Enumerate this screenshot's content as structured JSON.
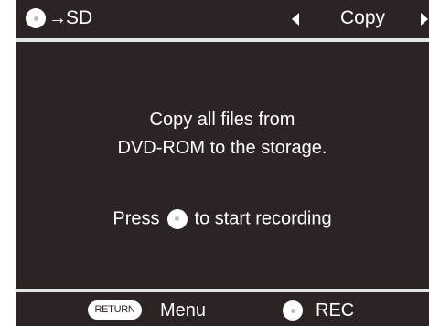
{
  "header": {
    "arrow": "→",
    "destination": "SD",
    "mode": "Copy"
  },
  "message": {
    "line1": "Copy all files from",
    "line2": "DVD-ROM to the storage.",
    "press_prefix": "Press",
    "press_suffix": "to start recording"
  },
  "footer": {
    "return_label": "RETURN",
    "menu_label": "Menu",
    "rec_label": "REC"
  },
  "colors": {
    "background": "#2b2422",
    "foreground": "#ffffff",
    "divider": "#e4e4e4"
  }
}
